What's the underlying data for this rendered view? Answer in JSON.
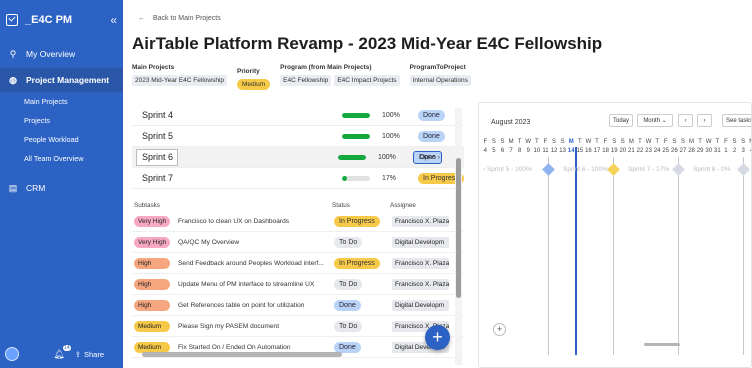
{
  "app": {
    "title": "_E4C PM",
    "collapse_icon": "double-chevron-left-icon"
  },
  "sidebar": {
    "items": [
      {
        "label": "My Overview",
        "icon": "pin-icon"
      },
      {
        "label": "Project Management",
        "icon": "globe-icon",
        "active": true
      },
      {
        "label": "CRM",
        "icon": "grid-icon"
      }
    ],
    "sub_items": [
      "Main Projects",
      "Projects",
      "People Workload",
      "All Team Overview"
    ],
    "notif_count": "14",
    "share_label": "Share"
  },
  "header": {
    "back_label": "Back to Main Projects",
    "title": "AirTable Platform Revamp  - 2023 Mid-Year E4C Fellowship"
  },
  "meta": {
    "main_projects_label": "Main Projects",
    "main_projects_value": "2023 Mid-Year E4C Fellowship",
    "priority_label": "Priority",
    "priority_value": "Medium",
    "program_label": "Program (from Main Projects)",
    "program_values": [
      "E4C Fellowship",
      "E4C Impact Projects"
    ],
    "program_to_project_label": "ProgramToProject",
    "program_to_project_value": "Internal Operations"
  },
  "sprints": [
    {
      "name": "Sprint 4",
      "progress": 100,
      "pct_label": "100%",
      "status": "Done"
    },
    {
      "name": "Sprint 5",
      "progress": 100,
      "pct_label": "100%",
      "status": "Done"
    },
    {
      "name": "Sprint 6",
      "progress": 100,
      "pct_label": "100%",
      "status": "Done",
      "open_label": "Open ›"
    },
    {
      "name": "Sprint 7",
      "progress": 17,
      "pct_label": "17%",
      "status": "In Progress"
    }
  ],
  "subtasks": {
    "headers": {
      "subtasks": "Subtasks",
      "status": "Status",
      "assignee": "Assignee"
    },
    "rows": [
      {
        "priority": "Very High",
        "task": "Francisco to clean UX on Dashboards",
        "status": "In Progress",
        "assignee": "Francisco X. Plaza"
      },
      {
        "priority": "Very High",
        "task": "QA/QC My Overview",
        "status": "To Do",
        "assignee": "Digital Developm"
      },
      {
        "priority": "High",
        "task": "Send Feedback around Peoples Workload interf...",
        "status": "In Progress",
        "assignee": "Francisco X. Plaza"
      },
      {
        "priority": "High",
        "task": "Update Menu of PM interface to streamline UX",
        "status": "To Do",
        "assignee": "Francisco X. Plaza"
      },
      {
        "priority": "High",
        "task": "Get References table on point for utilization",
        "status": "Done",
        "assignee": "Digital Developm"
      },
      {
        "priority": "Medium",
        "task": "Please Sign my PASEM document",
        "status": "To Do",
        "assignee": "Francisco X. Plaza"
      },
      {
        "priority": "Medium",
        "task": "Fix Started On / Ended On Automation",
        "status": "Done",
        "assignee": "Digital Developm"
      }
    ]
  },
  "gantt": {
    "month": "August 2023",
    "today_label": "Today",
    "view_label": "Month ⌄",
    "prev_icon": "chevron-left-icon",
    "next_icon": "chevron-right-icon",
    "see_tasks_label": "See tasks (",
    "day_letters": [
      "F",
      "S",
      "S",
      "M",
      "T",
      "W",
      "T",
      "F",
      "S",
      "S",
      "M",
      "T",
      "W",
      "T",
      "F",
      "S",
      "S",
      "M",
      "T",
      "W",
      "T",
      "F",
      "S",
      "S",
      "M",
      "T",
      "W",
      "T",
      "F",
      "S",
      "S",
      "M"
    ],
    "day_numbers": [
      "4",
      "5",
      "6",
      "7",
      "8",
      "9",
      "10",
      "11",
      "12",
      "13",
      "14",
      "15",
      "16",
      "17",
      "18",
      "19",
      "20",
      "21",
      "22",
      "23",
      "24",
      "25",
      "26",
      "27",
      "28",
      "29",
      "30",
      "31",
      "1",
      "2",
      "3",
      "4"
    ],
    "labels": [
      "‹ Sprint 5 - 100%",
      "Sprint 6 - 100%",
      "Sprint 7 - 17%",
      "Sprint 8 - 0%"
    ],
    "colors": {
      "done": "#8fb4ee",
      "progress": "#f7d25a",
      "todo": "#d5d9e2"
    }
  },
  "fab_label": "+"
}
